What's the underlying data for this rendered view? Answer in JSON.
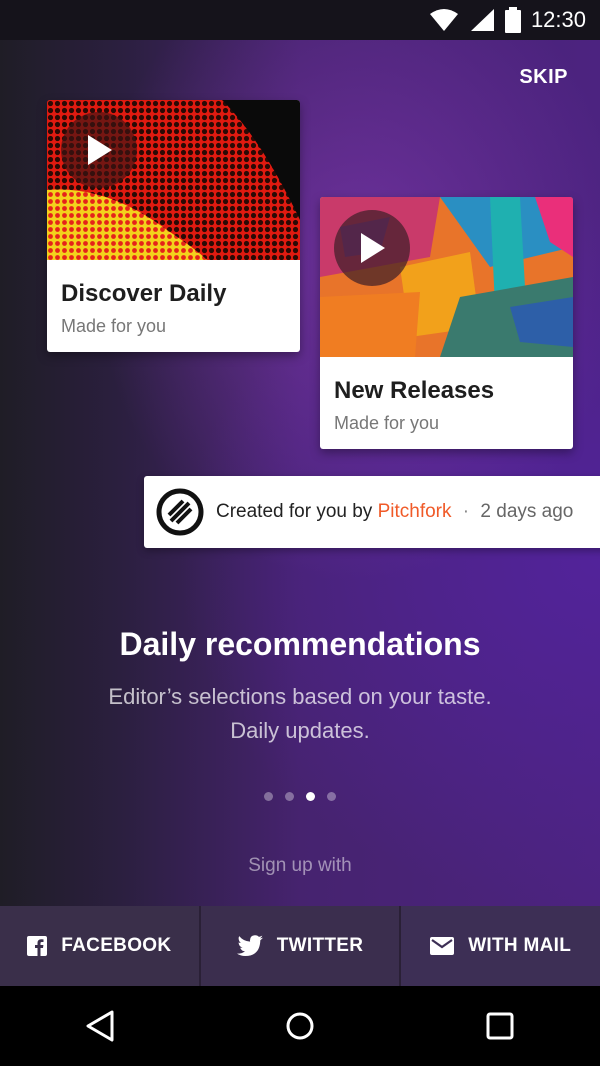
{
  "status_bar": {
    "time": "12:30"
  },
  "skip_label": "SKIP",
  "cards": [
    {
      "title": "Discover Daily",
      "subtitle": "Made for you"
    },
    {
      "title": "New Releases",
      "subtitle": "Made for you"
    }
  ],
  "credit": {
    "prefix": "Created for you by",
    "brand": "Pitchfork",
    "separator": "·",
    "age": "2 days ago",
    "brand_color": "#f05a28"
  },
  "headline": "Daily recommendations",
  "description": "Editor’s selections based on your taste. Daily updates.",
  "pager": {
    "count": 4,
    "active_index": 2
  },
  "signup_label": "Sign up with",
  "buttons": {
    "facebook": "FACEBOOK",
    "twitter": "TWITTER",
    "mail": "WITH MAIL"
  },
  "icons": {
    "status": [
      "wifi-icon",
      "signal-icon",
      "battery-icon"
    ],
    "nav": [
      "back-icon",
      "home-icon",
      "recents-icon"
    ]
  }
}
